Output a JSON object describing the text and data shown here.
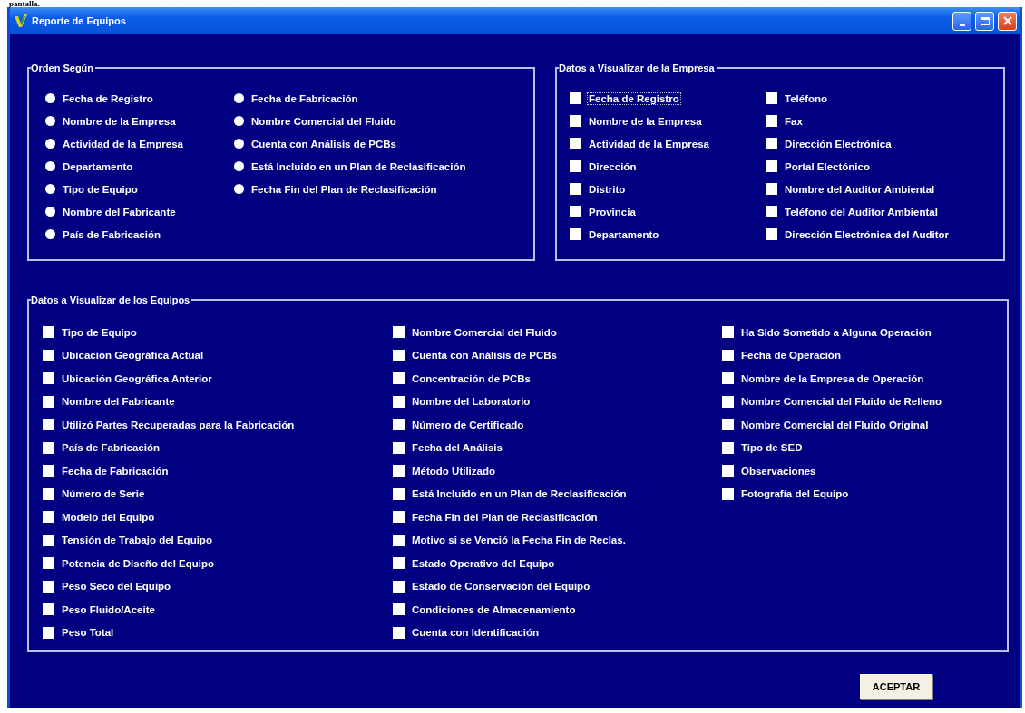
{
  "page_text": "pantalla.",
  "window": {
    "title": "Reporte de Equipos"
  },
  "order_by": {
    "legend": "Orden Según",
    "columns": [
      [
        {
          "label": "Fecha de Registro",
          "selected": false
        },
        {
          "label": "Nombre de la Empresa",
          "selected": false
        },
        {
          "label": "Actividad de la Empresa",
          "selected": false
        },
        {
          "label": "Departamento",
          "selected": false
        },
        {
          "label": "Tipo de Equipo",
          "selected": false
        },
        {
          "label": "Nombre del Fabricante",
          "selected": false
        },
        {
          "label": "País de Fabricación",
          "selected": false
        }
      ],
      [
        {
          "label": "Fecha de Fabricación",
          "selected": false
        },
        {
          "label": "Nombre Comercial del Fluido",
          "selected": false
        },
        {
          "label": "Cuenta con Análisis de PCBs",
          "selected": false
        },
        {
          "label": "Está Incluido en un Plan de Reclasificación",
          "selected": false
        },
        {
          "label": "Fecha Fin del Plan de Reclasificación",
          "selected": false
        }
      ]
    ]
  },
  "company_fields": {
    "legend": "Datos a Visualizar de la Empresa",
    "columns": [
      [
        {
          "label": "Fecha de Registro",
          "checked": false,
          "focused": true
        },
        {
          "label": "Nombre de la Empresa",
          "checked": false,
          "focused": false
        },
        {
          "label": "Actividad de la Empresa",
          "checked": false,
          "focused": false
        },
        {
          "label": "Dirección",
          "checked": false,
          "focused": false
        },
        {
          "label": "Distrito",
          "checked": false,
          "focused": false
        },
        {
          "label": "Provincia",
          "checked": false,
          "focused": false
        },
        {
          "label": "Departamento",
          "checked": false,
          "focused": false
        }
      ],
      [
        {
          "label": "Teléfono",
          "checked": false,
          "focused": false
        },
        {
          "label": "Fax",
          "checked": false,
          "focused": false
        },
        {
          "label": "Dirección Electrónica",
          "checked": false,
          "focused": false
        },
        {
          "label": "Portal Electónico",
          "checked": false,
          "focused": false
        },
        {
          "label": "Nombre del Auditor Ambiental",
          "checked": false,
          "focused": false
        },
        {
          "label": "Teléfono del Auditor Ambiental",
          "checked": false,
          "focused": false
        },
        {
          "label": "Dirección Electrónica del Auditor",
          "checked": false,
          "focused": false
        }
      ]
    ]
  },
  "equipment_fields": {
    "legend": "Datos a Visualizar de los Equipos",
    "columns": [
      [
        {
          "label": "Tipo de Equipo",
          "checked": false,
          "focused": false
        },
        {
          "label": "Ubicación Geográfica Actual",
          "checked": false,
          "focused": false
        },
        {
          "label": "Ubicación Geográfica Anterior",
          "checked": false,
          "focused": false
        },
        {
          "label": "Nombre del Fabricante",
          "checked": false,
          "focused": false
        },
        {
          "label": "Utilizó Partes Recuperadas para la Fabricación",
          "checked": false,
          "focused": false
        },
        {
          "label": "País de Fabricación",
          "checked": false,
          "focused": false
        },
        {
          "label": "Fecha de Fabricación",
          "checked": false,
          "focused": false
        },
        {
          "label": "Número de Serie",
          "checked": false,
          "focused": false
        },
        {
          "label": "Modelo del Equipo",
          "checked": false,
          "focused": false
        },
        {
          "label": "Tensión de Trabajo del Equipo",
          "checked": false,
          "focused": false
        },
        {
          "label": "Potencia de Diseño del Equipo",
          "checked": false,
          "focused": false
        },
        {
          "label": "Peso Seco del Equipo",
          "checked": false,
          "focused": false
        },
        {
          "label": "Peso Fluido/Aceite",
          "checked": false,
          "focused": false
        },
        {
          "label": "Peso Total",
          "checked": false,
          "focused": false
        }
      ],
      [
        {
          "label": "Nombre Comercial del Fluido",
          "checked": false,
          "focused": false
        },
        {
          "label": "Cuenta con Análisis de PCBs",
          "checked": false,
          "focused": false
        },
        {
          "label": "Concentración de PCBs",
          "checked": false,
          "focused": false
        },
        {
          "label": "Nombre del Laboratorio",
          "checked": false,
          "focused": false
        },
        {
          "label": "Número de Certificado",
          "checked": false,
          "focused": false
        },
        {
          "label": "Fecha del Análisis",
          "checked": false,
          "focused": false
        },
        {
          "label": "Método Utilizado",
          "checked": false,
          "focused": false
        },
        {
          "label": "Está Incluido en un Plan de Reclasificación",
          "checked": false,
          "focused": false
        },
        {
          "label": "Fecha Fin del Plan de Reclasificación",
          "checked": false,
          "focused": false
        },
        {
          "label": "Motivo si se Venció la Fecha Fin de Reclas.",
          "checked": false,
          "focused": false
        },
        {
          "label": "Estado Operativo del Equipo",
          "checked": false,
          "focused": false
        },
        {
          "label": "Estado de Conservación del Equipo",
          "checked": false,
          "focused": false
        },
        {
          "label": "Condiciones de Almacenamiento",
          "checked": false,
          "focused": false
        },
        {
          "label": "Cuenta con Identificación",
          "checked": false,
          "focused": false
        }
      ],
      [
        {
          "label": "Ha Sido Sometido a Alguna Operación",
          "checked": false,
          "focused": false
        },
        {
          "label": "Fecha de Operación",
          "checked": false,
          "focused": false
        },
        {
          "label": "Nombre de la Empresa de Operación",
          "checked": false,
          "focused": false
        },
        {
          "label": "Nombre Comercial del Fluido de Relleno",
          "checked": false,
          "focused": false
        },
        {
          "label": "Nombre Comercial del Fluido Original",
          "checked": false,
          "focused": false
        },
        {
          "label": "Tipo de SED",
          "checked": false,
          "focused": false
        },
        {
          "label": "Observaciones",
          "checked": false,
          "focused": false
        },
        {
          "label": "Fotografía del Equipo",
          "checked": false,
          "focused": false
        }
      ]
    ]
  },
  "buttons": [
    {
      "label": "ACEPTAR"
    }
  ]
}
